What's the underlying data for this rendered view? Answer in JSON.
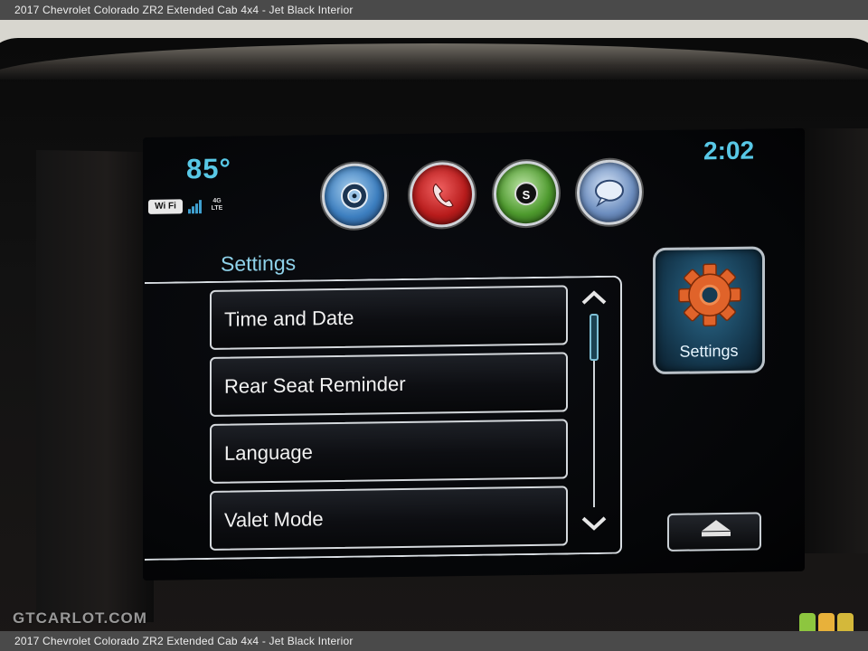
{
  "captions": {
    "top": "2017 Chevrolet Colorado ZR2 Extended Cab 4x4 - Jet Black Interior",
    "bottom": "2017 Chevrolet Colorado ZR2 Extended Cab 4x4 - Jet Black Interior"
  },
  "status_bar": {
    "temperature": "85°",
    "time": "2:02",
    "wifi_label": "Wi Fi",
    "network_label": "4G LTE",
    "signal_bars": 4
  },
  "app_icons": [
    {
      "name": "audio",
      "icon": "speaker-icon",
      "color": "#3d7fc0"
    },
    {
      "name": "phone",
      "icon": "phone-handset-icon",
      "color": "#b81c1c"
    },
    {
      "name": "navigation",
      "icon": "compass-icon",
      "color": "#4e9a2e",
      "glyph": "S"
    },
    {
      "name": "messages",
      "icon": "speech-bubble-icon",
      "color": "#6e8fc0"
    }
  ],
  "settings": {
    "title": "Settings",
    "items": [
      {
        "label": "Time and Date"
      },
      {
        "label": "Rear Seat Reminder"
      },
      {
        "label": "Language"
      },
      {
        "label": "Valet Mode"
      }
    ]
  },
  "side_tile": {
    "label": "Settings",
    "icon": "gear-icon",
    "gear_color": "#e0632a"
  },
  "home_button": {
    "icon": "eject-up-icon"
  },
  "watermark": "GTCARLOT.COM",
  "logo_colors": [
    "#8dc63f",
    "#e8b13a",
    "#d4b83a"
  ],
  "accent_color": "#58c8e6"
}
